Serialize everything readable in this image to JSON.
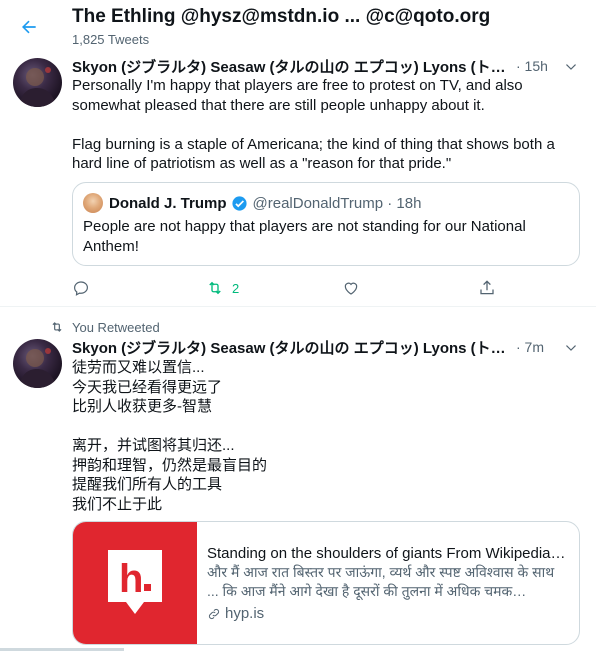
{
  "header": {
    "title": "The Ethling @hysz@mstdn.io ... @c@qoto.org",
    "subtitle": "1,825 Tweets"
  },
  "tweets": [
    {
      "author": "Skyon (ジブラルタ) Seasaw (タルの山の エプコッ) Lyons (トー…",
      "time": "· 15h",
      "text": "Personally I'm happy that players are free to protest on TV, and also somewhat pleased that there are still people unhappy about it.\n\nFlag burning is a staple of Americana; the kind of thing that shows both a hard line of patriotism as well as a \"reason for that pride.\"",
      "quote": {
        "name": "Donald J. Trump",
        "handle": "@realDonaldTrump · 18h",
        "text": "People are not happy that players are not standing for our National Anthem!"
      },
      "retweet_count": "2"
    },
    {
      "retweeted_label": "You Retweeted",
      "author": "Skyon (ジブラルタ) Seasaw (タルの山の エプコッ) Lyons (トー…",
      "time": "· 7m",
      "text": "徒劳而又难以置信...\n今天我已经看得更远了\n比别人收获更多-智慧\n\n离开，并试图将其归还...\n押韵和理智，仍然是最盲目的\n提醒我们所有人的工具\n我们不止于此",
      "card": {
        "title": "Standing on the shoulders of giants From Wikipedia, …",
        "description": "और मैं आज रात बिस्तर पर जाऊंगा, व्यर्थ और स्पष्ट अविश्वास के साथ ... कि आज मैंने आगे देखा है दूसरों की तुलना में अधिक चमक…",
        "domain": "hyp.is"
      }
    }
  ],
  "colors": {
    "accent": "#1d9bf0",
    "retweet_green": "#00ba7c",
    "card_image": "#e0262f",
    "muted": "#536471"
  },
  "icons": [
    "back-arrow-icon",
    "chevron-down-icon",
    "verified-badge-icon",
    "reply-icon",
    "retweet-icon",
    "like-icon",
    "share-icon",
    "link-icon",
    "hypothesis-logo"
  ]
}
